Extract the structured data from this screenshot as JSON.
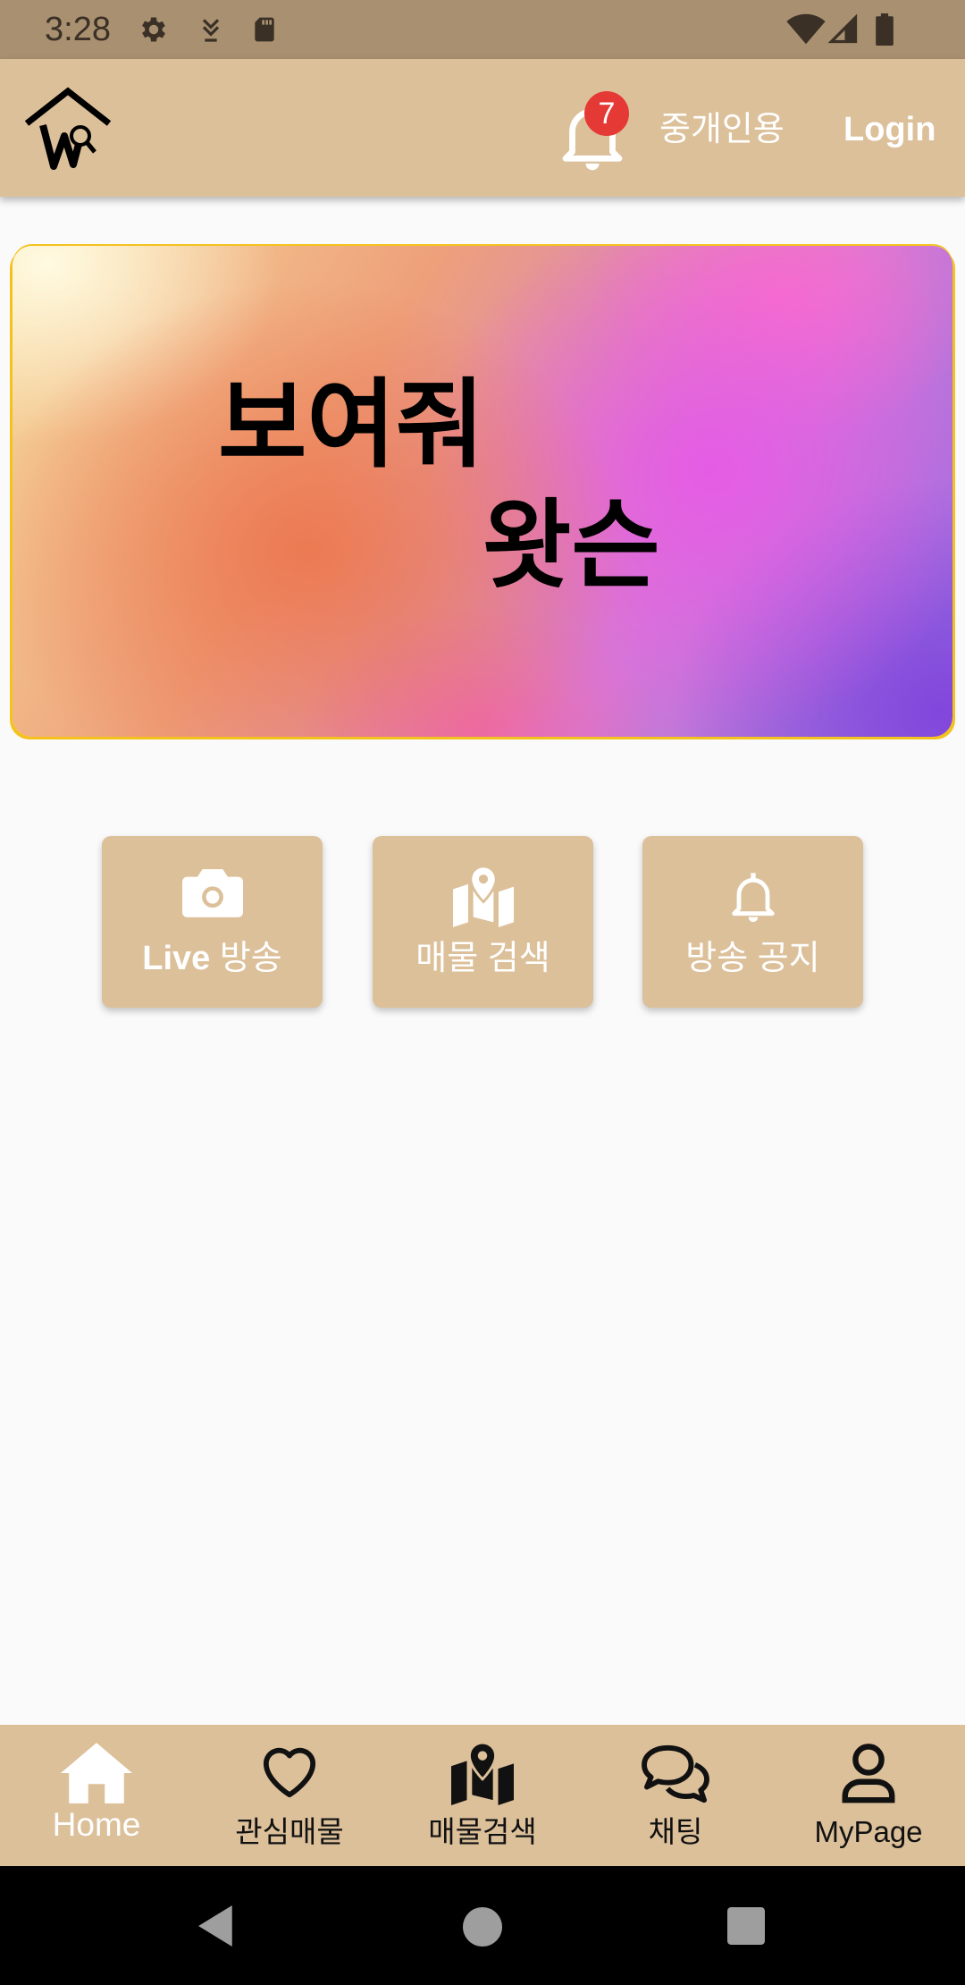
{
  "status_bar": {
    "time": "3:28",
    "icons": [
      "gear-icon",
      "download-icon",
      "sd-card-icon",
      "wifi-icon",
      "signal-icon",
      "battery-icon"
    ]
  },
  "app_bar": {
    "logo": "house-w-logo",
    "notification_count": "7",
    "broker_label": "중개인용",
    "login_label": "Login"
  },
  "banner": {
    "line1": "보여줘",
    "line2": "왓슨"
  },
  "menu": [
    {
      "icon": "camera-icon",
      "label_bold": "Live",
      "label": " 방송"
    },
    {
      "icon": "map-pin-icon",
      "label": "매물 검색"
    },
    {
      "icon": "bell-icon",
      "label": "방송 공지"
    }
  ],
  "bottom_nav": [
    {
      "icon": "home-icon",
      "label": "Home",
      "active": true
    },
    {
      "icon": "heart-icon",
      "label": "관심매물"
    },
    {
      "icon": "map-icon",
      "label": "매물검색"
    },
    {
      "icon": "chat-icon",
      "label": "채팅"
    },
    {
      "icon": "person-icon",
      "label": "MyPage"
    }
  ],
  "colors": {
    "app_bar": "#DCC09A",
    "status_bar": "#A89070",
    "badge": "#E53935",
    "background": "#FAFAFA"
  }
}
